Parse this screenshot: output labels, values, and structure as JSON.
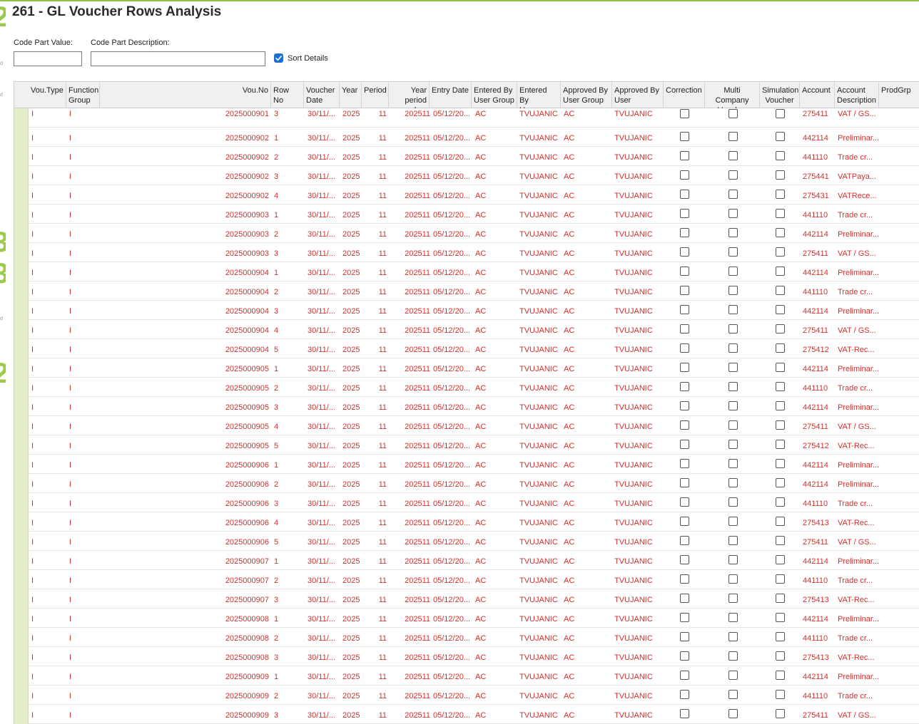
{
  "page": {
    "title": "261 - GL Voucher Rows Analysis"
  },
  "filters": {
    "code_part_value_label": "Code Part Value:",
    "code_part_value": "",
    "code_part_description_label": "Code Part Description:",
    "code_part_description": "",
    "sort_details_label": "Sort Details",
    "sort_details_checked": true
  },
  "columns": [
    "Vou.Type",
    "Function\nGroup",
    "Vou.No",
    "Row No",
    "Voucher\nDate",
    "Year",
    "Period",
    "Year\nperiod key",
    "Entry Date",
    "Entered By\nUser Group",
    "Entered By\nUser",
    "Approved By\nUser Group",
    "Approved By\nUser",
    "Correction",
    "Multi Company\nVoucher",
    "Simulation\nVoucher",
    "Account",
    "Account\nDescription",
    "ProdGrp"
  ],
  "row_defaults": {
    "vou_type": "I",
    "function_group": "I",
    "voucher_date": "30/11/...",
    "year": "2025",
    "period": "11",
    "year_period_key": "202511",
    "entry_date": "05/12/20...",
    "entered_by_user_group": "AC",
    "entered_by_user": "TVUJANIC",
    "approved_by_user_group": "AC",
    "approved_by_user": "TVUJANIC"
  },
  "rows": [
    {
      "vou_no": "2025000901",
      "row_no": "3",
      "account": "275411",
      "account_description": "VAT / GS..."
    },
    {
      "vou_no": "2025000902",
      "row_no": "1",
      "account": "442114",
      "account_description": "Preliminar..."
    },
    {
      "vou_no": "2025000902",
      "row_no": "2",
      "account": "441110",
      "account_description": "Trade cr..."
    },
    {
      "vou_no": "2025000902",
      "row_no": "3",
      "account": "275441",
      "account_description": "VATPaya..."
    },
    {
      "vou_no": "2025000902",
      "row_no": "4",
      "account": "275431",
      "account_description": "VATRece..."
    },
    {
      "vou_no": "2025000903",
      "row_no": "1",
      "account": "441110",
      "account_description": "Trade cr..."
    },
    {
      "vou_no": "2025000903",
      "row_no": "2",
      "account": "442114",
      "account_description": "Preliminar..."
    },
    {
      "vou_no": "2025000903",
      "row_no": "3",
      "account": "275411",
      "account_description": "VAT / GS..."
    },
    {
      "vou_no": "2025000904",
      "row_no": "1",
      "account": "442114",
      "account_description": "Preliminar..."
    },
    {
      "vou_no": "2025000904",
      "row_no": "2",
      "account": "441110",
      "account_description": "Trade cr..."
    },
    {
      "vou_no": "2025000904",
      "row_no": "3",
      "account": "442114",
      "account_description": "Preliminar..."
    },
    {
      "vou_no": "2025000904",
      "row_no": "4",
      "account": "275411",
      "account_description": "VAT / GS..."
    },
    {
      "vou_no": "2025000904",
      "row_no": "5",
      "account": "275412",
      "account_description": "VAT-Rec..."
    },
    {
      "vou_no": "2025000905",
      "row_no": "1",
      "account": "442114",
      "account_description": "Preliminar..."
    },
    {
      "vou_no": "2025000905",
      "row_no": "2",
      "account": "441110",
      "account_description": "Trade cr..."
    },
    {
      "vou_no": "2025000905",
      "row_no": "3",
      "account": "442114",
      "account_description": "Preliminar..."
    },
    {
      "vou_no": "2025000905",
      "row_no": "4",
      "account": "275411",
      "account_description": "VAT / GS..."
    },
    {
      "vou_no": "2025000905",
      "row_no": "5",
      "account": "275412",
      "account_description": "VAT-Rec..."
    },
    {
      "vou_no": "2025000906",
      "row_no": "1",
      "account": "442114",
      "account_description": "Preliminar..."
    },
    {
      "vou_no": "2025000906",
      "row_no": "2",
      "account": "442114",
      "account_description": "Preliminar..."
    },
    {
      "vou_no": "2025000906",
      "row_no": "3",
      "account": "441110",
      "account_description": "Trade cr..."
    },
    {
      "vou_no": "2025000906",
      "row_no": "4",
      "account": "275413",
      "account_description": "VAT-Rec..."
    },
    {
      "vou_no": "2025000906",
      "row_no": "5",
      "account": "275411",
      "account_description": "VAT / GS..."
    },
    {
      "vou_no": "2025000907",
      "row_no": "1",
      "account": "442114",
      "account_description": "Preliminar..."
    },
    {
      "vou_no": "2025000907",
      "row_no": "2",
      "account": "441110",
      "account_description": "Trade cr..."
    },
    {
      "vou_no": "2025000907",
      "row_no": "3",
      "account": "275413",
      "account_description": "VAT-Rec..."
    },
    {
      "vou_no": "2025000908",
      "row_no": "1",
      "account": "442114",
      "account_description": "Preliminar..."
    },
    {
      "vou_no": "2025000908",
      "row_no": "2",
      "account": "441110",
      "account_description": "Trade cr..."
    },
    {
      "vou_no": "2025000908",
      "row_no": "3",
      "account": "275413",
      "account_description": "VAT-Rec..."
    },
    {
      "vou_no": "2025000909",
      "row_no": "1",
      "account": "442114",
      "account_description": "Preliminar..."
    },
    {
      "vou_no": "2025000909",
      "row_no": "2",
      "account": "441110",
      "account_description": "Trade cr..."
    },
    {
      "vou_no": "2025000909",
      "row_no": "3",
      "account": "275411",
      "account_description": "VAT / GS..."
    }
  ],
  "colors": {
    "accent": "#8dc63f",
    "row_text": "#d0312d",
    "selection_bar": "#e3edc8",
    "checkbox_checked": "#1f6fd1"
  }
}
